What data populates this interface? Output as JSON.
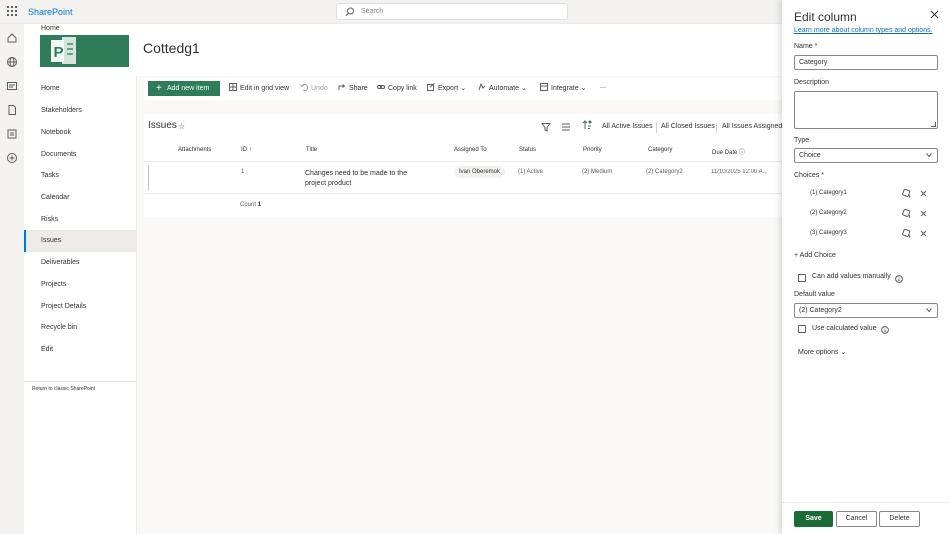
{
  "suite": {
    "brand": "SharePoint",
    "search_placeholder": "Search"
  },
  "header": {
    "breadcrumb": "Home",
    "site_title": "Cottedg1"
  },
  "nav": {
    "items": [
      "Home",
      "Stakeholders",
      "Notebook",
      "Documents",
      "Tasks",
      "Calendar",
      "Risks",
      "Issues",
      "Deliverables",
      "Projects",
      "Project Details",
      "Recycle bin",
      "Edit"
    ],
    "active": "Issues",
    "classic_link": "Return to classic SharePoint"
  },
  "commands": {
    "add_new_item": "Add new item",
    "edit_grid": "Edit in grid view",
    "undo": "Undo",
    "share": "Share",
    "copy_link": "Copy link",
    "export": "Export",
    "automate": "Automate",
    "integrate": "Integrate",
    "more": "..."
  },
  "list": {
    "title": "Issues",
    "views": [
      "All Active Issues",
      "All Closed Issues",
      "All Issues Assigned"
    ],
    "columns": [
      "Attachments",
      "ID",
      "Title",
      "Assigned To",
      "Status",
      "Priority",
      "Category",
      "Due Date"
    ],
    "rows": [
      {
        "id": "1",
        "title": "Changes need to be made to the project product",
        "assigned_to": "Ivan Oberemok",
        "status": "(1) Active",
        "priority": "(2) Medium",
        "category": "(2) Category2",
        "due_date": "11/10/2025 12:00 A..."
      }
    ],
    "count_label": "Count",
    "count_value": "1"
  },
  "panel": {
    "title": "Edit column",
    "learn_more": "Learn more about column types and options.",
    "name_label": "Name *",
    "name_value": "Category",
    "description_label": "Description",
    "type_label": "Type",
    "type_value": "Choice",
    "choices_label": "Choices *",
    "choices": [
      "(1) Category1",
      "(2) Category2",
      "(3) Category3"
    ],
    "add_choice": "Add Choice",
    "can_add_manually": "Can add values manually",
    "default_value_label": "Default value",
    "default_value": "(2) Category2",
    "use_calculated": "Use calculated value",
    "more_options": "More options",
    "save": "Save",
    "cancel": "Cancel",
    "delete": "Delete"
  },
  "colors": {
    "accent": "#2e7d58",
    "primary_button": "#1b6b37",
    "link": "#0f6cbd"
  }
}
